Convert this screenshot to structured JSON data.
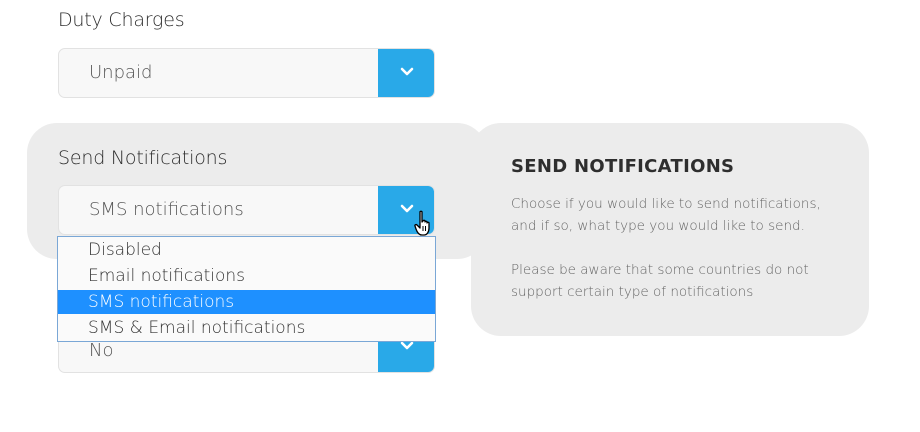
{
  "duty": {
    "label": "Duty Charges",
    "value": "Unpaid"
  },
  "notifications": {
    "label": "Send Notifications",
    "value": "SMS notifications",
    "options": [
      "Disabled",
      "Email notifications",
      "SMS notifications",
      "SMS & Email notifications"
    ],
    "selected_index": 2
  },
  "hidden_select": {
    "value": "No"
  },
  "info": {
    "title": "SEND NOTIFICATIONS",
    "text1": "Choose if you would like to send notifications, and if so, what type you would like to send.",
    "text2": "Please be aware that some countries do not support certain type of notifications"
  },
  "icons": {
    "dropdown_arrow": "chevron-down-icon",
    "cursor": "hand-pointer-icon"
  },
  "colors": {
    "accent": "#29a9e8",
    "selected": "#1e90ff",
    "panel": "#ececec"
  }
}
